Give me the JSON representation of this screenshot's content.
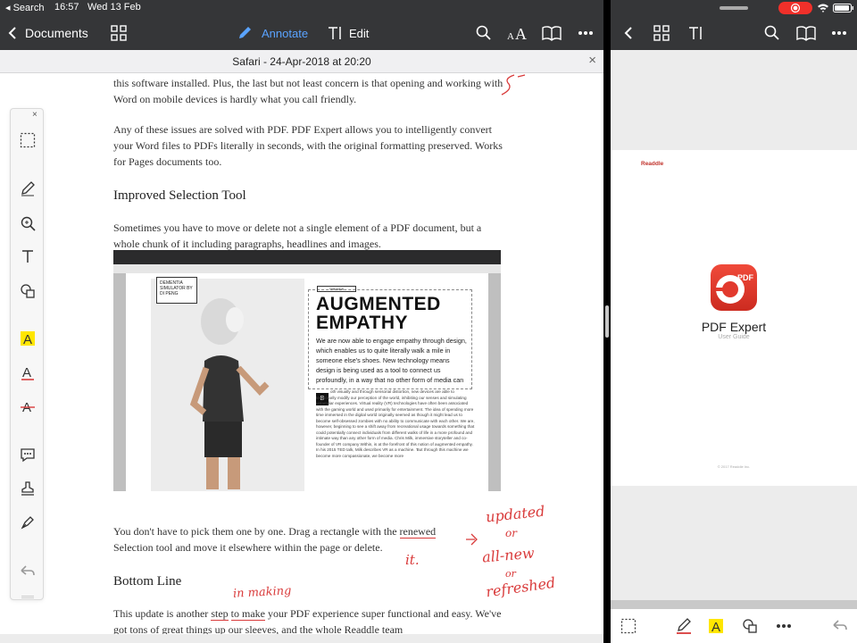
{
  "status": {
    "carrier": "Search",
    "time": "16:57",
    "date": "Wed 13 Feb"
  },
  "nav": {
    "back_label": "Documents",
    "annotate_label": "Annotate",
    "edit_label": "Edit",
    "accent": "#5aa3ff"
  },
  "docbar": {
    "title": "Safari - 24-Apr-2018 at 20:20",
    "close": "×"
  },
  "document": {
    "para1": "this software installed. Plus, the last but not least concern is that opening and working with Word on mobile devices is hardly what you call friendly.",
    "para2": "Any of these issues are solved with PDF. PDF Expert allows you to intelligently convert your Word files to PDFs literally in seconds, with the original formatting preserved. Works for Pages documents too.",
    "heading1": "Improved Selection Tool",
    "para3": "Sometimes you have to move or delete not a single element of a PDF document, but a whole chunk of it including paragraphs, headlines and images.",
    "para4_a": "You don't have to pick them one by one. Drag a rectangle with the ",
    "para4_mark": "renewed",
    "para4_b": " Selection tool and move it elsewhere within the page or delete.",
    "heading2": "Bottom Line",
    "para5_a": "This update is another ",
    "para5_mark1": "step",
    "para5_mid": " ",
    "para5_mark2": "to make",
    "para5_b": " your PDF experience super functional and easy. We've got tons of great things up our sleeves, and the whole Readdle team"
  },
  "article_image": {
    "badge": "DEMENTIA SIMULATOR BY DI PENG",
    "tag": "TRENDS",
    "title": "AUGMENTED EMPATHY",
    "intro": "We are now able to engage empathy through design, which enables us to quite literally walk a mile in someone else's shoes. New technology means design is being used as a tool to connect us profoundly, in a way that no other form of media can",
    "dropcap": "B",
    "body": "oth visually and through sensorial distortion, new devices are able to temporarily modify our perception of the world, inhibiting our senses and simulating unfamiliar experiences. Virtual reality (VR) technologies have often been associated with the gaming world and used primarily for entertainment. The idea of spending more time immersed in the digital world originally seemed as though it might lead us to become self-obsessed zombies with no ability to communicate with each other. We are, however, beginning to see a shift away from recreational usage towards something that could potentially connect individuals from different walks of life in a more profound and intimate way than any other form of media. Chris Milk, immersive storyteller and co-founder of VR company Within, is at the forefront of this notion of augmented empathy. In his 2015 TED talk, Milk describes VR as a machine. 'But through this machine we become more compassionate, we become more"
  },
  "handwriting": {
    "updated": "updated",
    "or1": "or",
    "allnew": "all-new",
    "or2": "or",
    "refreshed": "refreshed",
    "it": "it.",
    "inmaking": "in making",
    "color": "#d93a3a"
  },
  "toolbar": {
    "close": "×",
    "highlight_color": "#ffe600",
    "underline_color": "#d93a3a"
  },
  "right_pane": {
    "brand": "Readdle",
    "app_name": "PDF Expert",
    "app_sub": "User Guide",
    "icon_label": "PDF",
    "copyright": "© 2017 Readdle Inc."
  }
}
